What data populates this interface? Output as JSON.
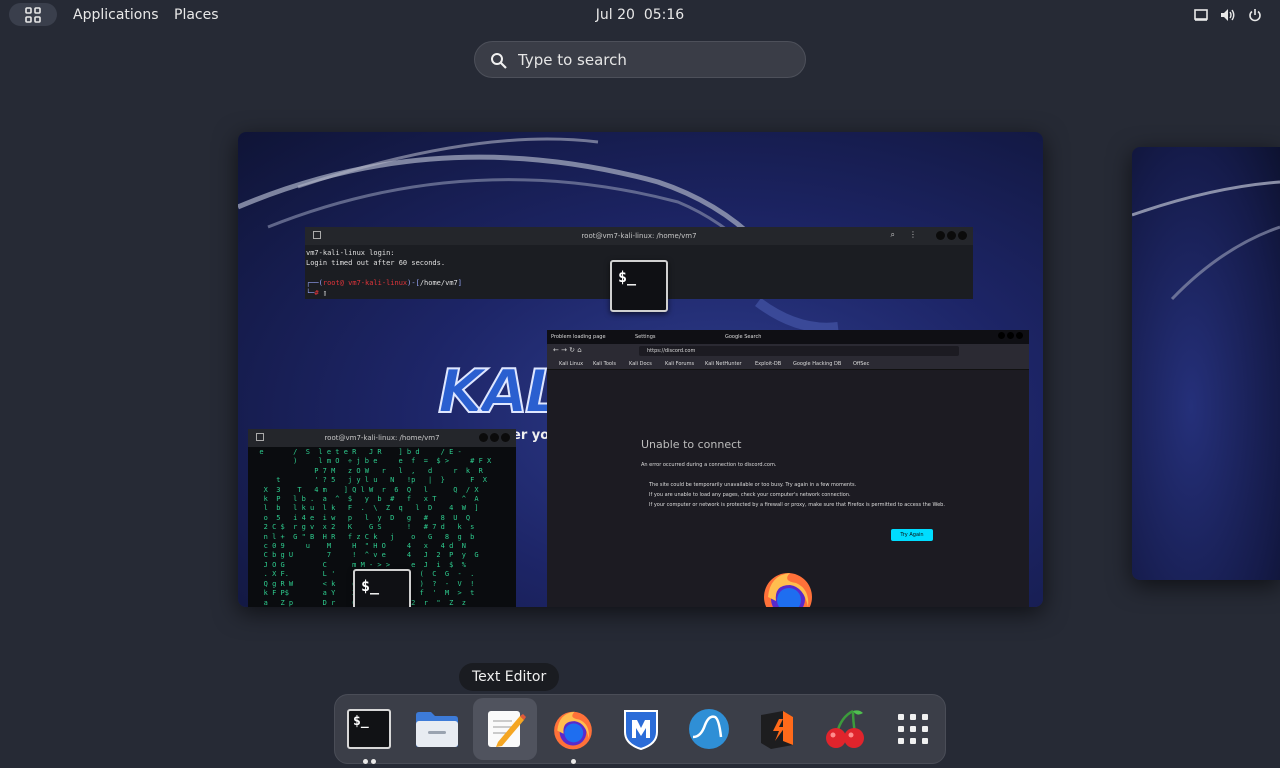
{
  "topbar": {
    "apps_grid_icon": "grid-icon",
    "applications_label": "Applications",
    "places_label": "Places",
    "clock": "Jul 20  05:16",
    "tray_icons": [
      "screen-icon",
      "volume-icon",
      "power-icon"
    ]
  },
  "search": {
    "placeholder": "Type to search",
    "value": ""
  },
  "windows": {
    "terminal_top": {
      "title": "root@vm7-kali-linux: /home/vm7",
      "line1": "vm7-kali-linux login:",
      "line2": "Login timed out after 60 seconds.",
      "prompt_user": "root@ vm7-kali-linux",
      "prompt_path": "/home/vm7",
      "prompt_sym": "#"
    },
    "terminal_matrix": {
      "title": "root@vm7-kali-linux: /home/vm7"
    },
    "firefox": {
      "tabs": [
        "Problem loading page",
        "Settings",
        "Google Search"
      ],
      "url": "https://discord.com",
      "bookmarks": [
        "Kali Linux",
        "Kali Tools",
        "Kali Docs",
        "Kali Forums",
        "Kali NetHunter",
        "Exploit-DB",
        "Google Hacking DB",
        "OffSec"
      ],
      "error_title": "Unable to connect",
      "error_desc": "An error occurred during a connection to discord.com.",
      "bullets": [
        "The site could be temporarily unavailable or too busy. Try again in a few moments.",
        "If you are unable to load any pages, check your computer's network connection.",
        "If your computer or network is protected by a firewall or proxy, make sure that Firefox is permitted to access the Web."
      ],
      "try_again": "Try Again"
    },
    "wallpaper_logo": "KALI",
    "wallpaper_tagline": "er yo",
    "terminal_badge": "$_"
  },
  "tooltip": "Text Editor",
  "dock": {
    "items": [
      {
        "name": "terminal",
        "icon": "terminal-icon",
        "running_dots": 2
      },
      {
        "name": "files",
        "icon": "folder-icon",
        "running_dots": 0
      },
      {
        "name": "text-editor",
        "icon": "text-editor-icon",
        "running_dots": 0,
        "active": true
      },
      {
        "name": "firefox",
        "icon": "firefox-icon",
        "running_dots": 1
      },
      {
        "name": "metasploit",
        "icon": "metasploit-icon",
        "running_dots": 0
      },
      {
        "name": "wireshark",
        "icon": "wireshark-icon",
        "running_dots": 0
      },
      {
        "name": "burpsuite",
        "icon": "burpsuite-icon",
        "running_dots": 0
      },
      {
        "name": "cherrytree",
        "icon": "cherry-icon",
        "running_dots": 0
      },
      {
        "name": "show-apps",
        "icon": "app-grid-icon",
        "running_dots": 0
      }
    ]
  }
}
